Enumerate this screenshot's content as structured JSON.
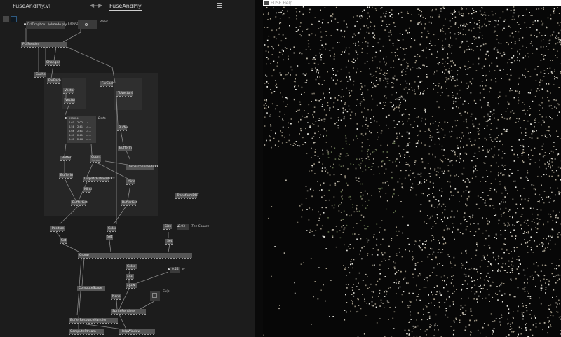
{
  "editor": {
    "doc_title": "FuseAndPly.vl",
    "doc_caret": "▾",
    "nav_arrows": "◀—▶",
    "patch_tab": "FuseAndPly",
    "nodes": {
      "file_path_value": "D:\\Dropbox...\\olmedo.ply",
      "file_path_label": "File Path",
      "read_label": "Read",
      "ply_reader": "PLYReader",
      "changed": "Changed",
      "cache": "Cache",
      "foreach_left": "ForEach",
      "foreach_right": "ForEach",
      "vector_top": "Vector",
      "vector_bottom": "Vector",
      "tovector4": "ToVector4",
      "data_label": "Data",
      "spread_count": "293024",
      "spread_rows": [
        [
          "0.61",
          "2.02",
          "-4..."
        ],
        [
          "0.58",
          "2.41",
          "-4..."
        ],
        [
          "0.66",
          "2.41",
          "-4..."
        ],
        [
          "0.67",
          "2.41",
          "-4..."
        ],
        [
          "0.61",
          "2.46",
          "-4..."
        ]
      ],
      "buffer_right": "Buffer",
      "bufferin_right": "BufferIn",
      "buffer_left": "Buffer",
      "bufferin_left": "BufferIn",
      "count": "Count",
      "count_sub": "Spread",
      "dispatch_right": "DispatchThreadsXX",
      "dispatch_mid": "DispatchThreadsXX",
      "mind_right": "Mind",
      "mind_mid": "Mind",
      "transform_drt": "TransformDRT",
      "bufferget_left": "BufferGet",
      "bufferget_right": "BufferGet",
      "position": "Position",
      "color": "Color",
      "size": "Size",
      "size_value": "0.03",
      "the_source": "The Source",
      "set_1": "Set",
      "set_2": "Set",
      "set_3": "Set",
      "group": "Group",
      "color2": "Color",
      "xyz": "xyz",
      "xyzw": "xyzw",
      "val_022": "0.22",
      "w_label": "w",
      "compute_stage": "ComputeStage",
      "none": "None",
      "skip": "Skip",
      "sprite_renderer": "SpriteRenderer",
      "buffer_resource": "BufferResourceHandler",
      "compute_stream": "ComputeStream",
      "help_window": "HelpWindow"
    }
  },
  "viewer": {
    "window_title": "FUSE Help"
  }
}
